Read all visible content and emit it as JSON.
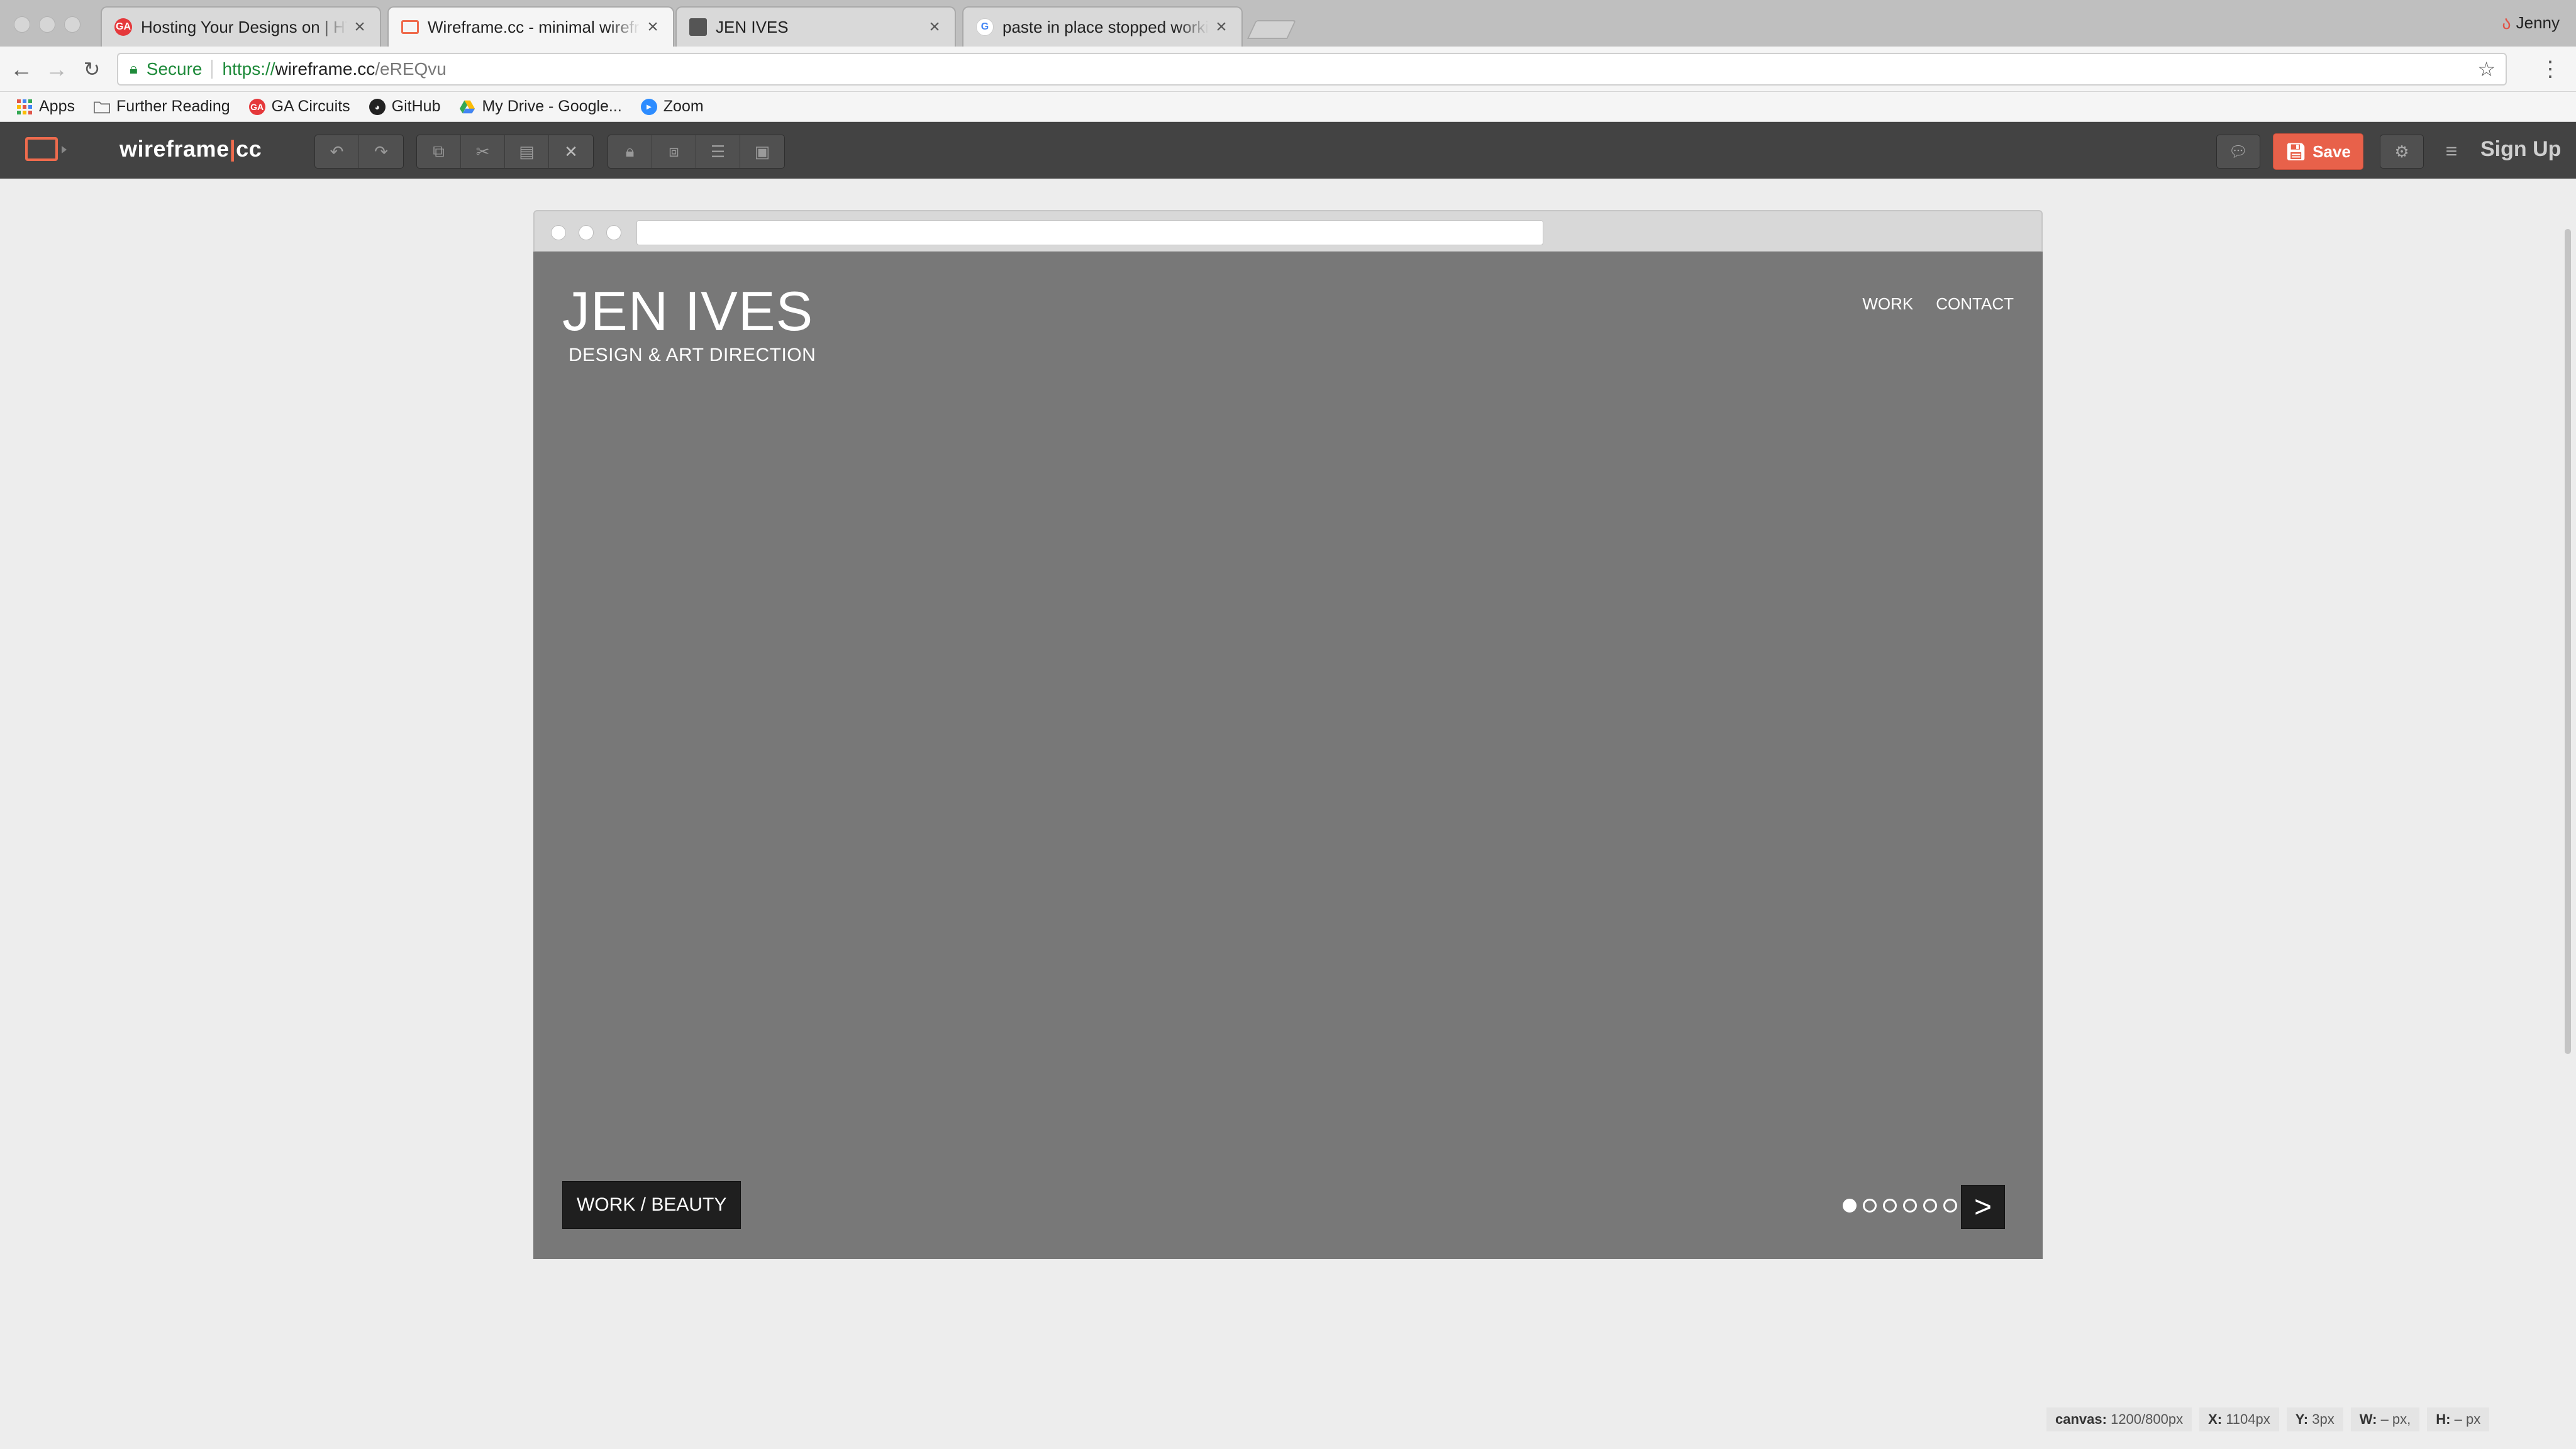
{
  "browser": {
    "tabs": [
      {
        "title": "Hosting Your Designs on | HTML",
        "favicon": "ga-icon",
        "active": false
      },
      {
        "title": "Wireframe.cc - minimal wireframing tool",
        "favicon": "wireframe-icon",
        "active": true
      },
      {
        "title": "JEN IVES",
        "favicon": "cube-icon",
        "active": false
      },
      {
        "title": "paste in place stopped working",
        "favicon": "google-icon",
        "active": false
      }
    ],
    "profile_name": "Jenny",
    "address": {
      "secure_label": "Secure",
      "url_scheme": "https://",
      "url_host": "wireframe.cc",
      "url_path": "/eREQvu"
    },
    "bookmarks": [
      {
        "label": "Apps",
        "icon": "apps-grid-icon"
      },
      {
        "label": "Further Reading",
        "icon": "folder-icon"
      },
      {
        "label": "GA Circuits",
        "icon": "ga-icon"
      },
      {
        "label": "GitHub",
        "icon": "github-icon"
      },
      {
        "label": "My Drive - Google...",
        "icon": "drive-icon"
      },
      {
        "label": "Zoom",
        "icon": "zoom-icon"
      }
    ]
  },
  "app": {
    "brand_left": "wireframe",
    "brand_sep": "|",
    "brand_right": "cc",
    "save_label": "Save",
    "signup_label": "Sign Up",
    "accent_color": "#e8614a"
  },
  "wireframe": {
    "site_title": "JEN IVES",
    "tagline": "DESIGN & ART DIRECTION",
    "nav": [
      "WORK",
      "CONTACT"
    ],
    "caption": "WORK / BEAUTY",
    "slides_total": 6,
    "slide_active": 1,
    "next_label": ">"
  },
  "status": {
    "canvas_label": "canvas:",
    "canvas_value": "1200/800px",
    "x_label": "X:",
    "x_value": "1104px",
    "y_label": "Y:",
    "y_value": "3px",
    "w_label": "W:",
    "w_value": "– px,",
    "h_label": "H:",
    "h_value": "– px"
  }
}
